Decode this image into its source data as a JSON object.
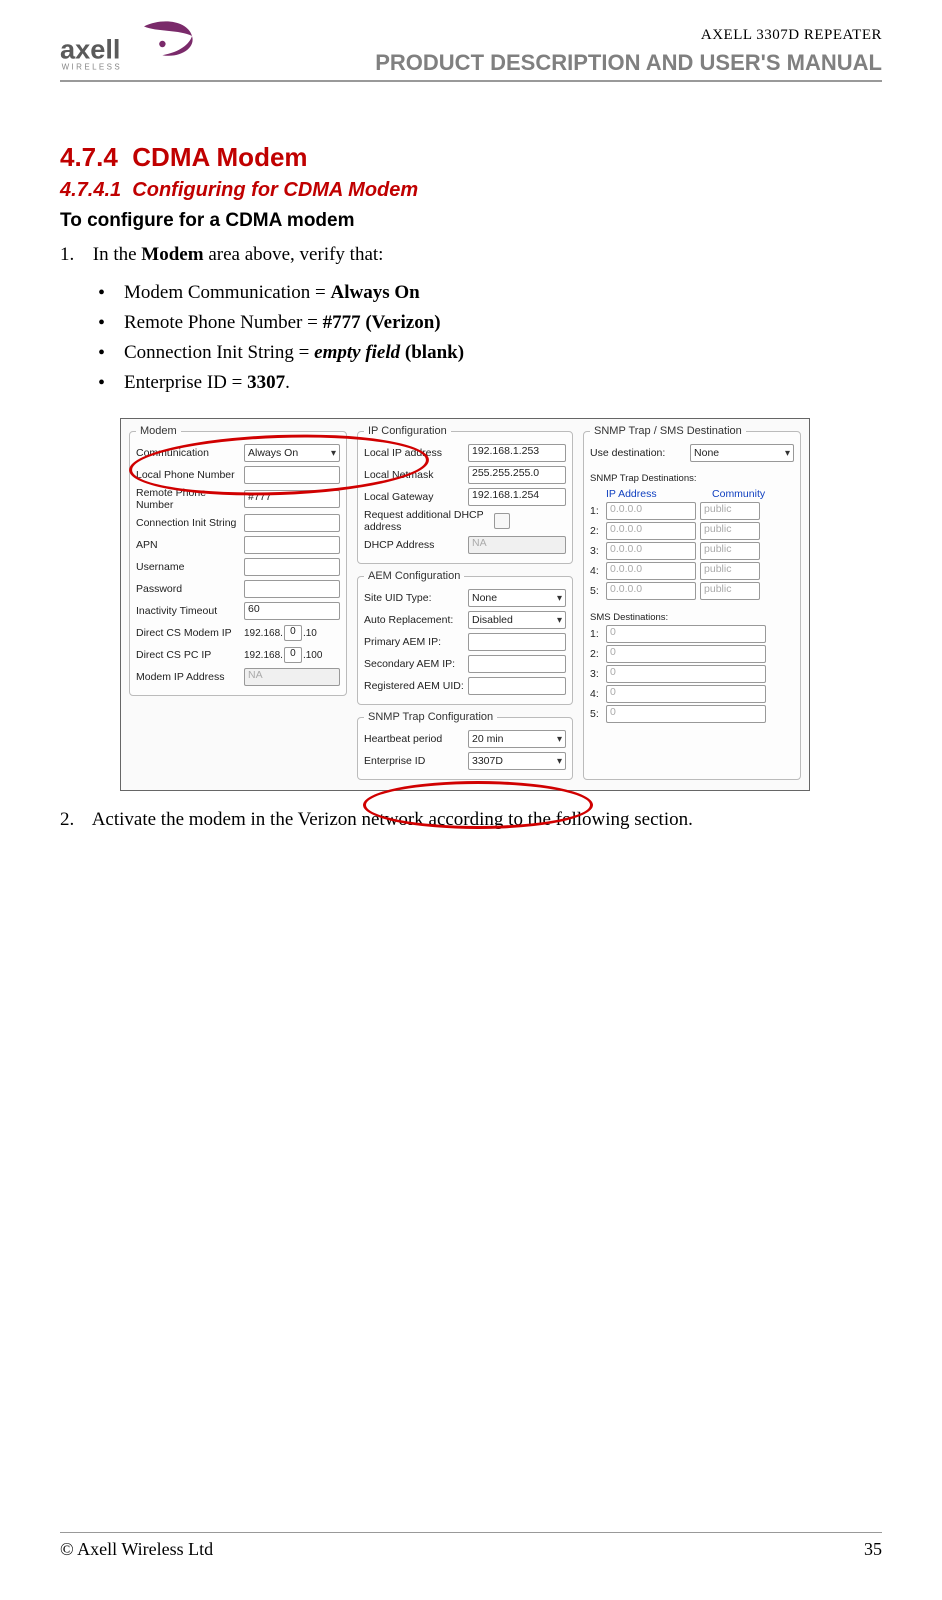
{
  "header": {
    "logo_brand": "axell",
    "logo_tag": "WIRELESS",
    "product": "AXELL 3307D REPEATER",
    "manual": "PRODUCT DESCRIPTION AND USER'S MANUAL"
  },
  "section": {
    "num_474": "4.7.4",
    "title_474": "CDMA Modem",
    "num_4741": "4.7.4.1",
    "title_4741": "Configuring for CDMA Modem",
    "proc_title": "To configure for a CDMA modem",
    "step1_prefix": "1.",
    "step1_text_a": "In the ",
    "step1_bold": "Modem",
    "step1_text_b": " area above, verify that:",
    "bullets": {
      "b1a": "Modem Communication  = ",
      "b1b": "Always On",
      "b2a": "Remote Phone Number = ",
      "b2b": "#777 (Verizon)",
      "b3a": "Connection Init String = ",
      "b3b_em": "empty field",
      "b3c": " (blank)",
      "b4a": "Enterprise ID = ",
      "b4b": "3307",
      "b4c": "."
    },
    "step2_prefix": "2.",
    "step2_text": "Activate the modem in the Verizon network according to the following section."
  },
  "fig": {
    "modem": {
      "legend": "Modem",
      "communication_label": "Communication",
      "communication_value": "Always On",
      "local_phone_label": "Local Phone Number",
      "local_phone_value": "",
      "remote_phone_label": "Remote Phone Number",
      "remote_phone_value": "#777",
      "conn_init_label": "Connection Init String",
      "conn_init_value": "",
      "apn_label": "APN",
      "apn_value": "",
      "username_label": "Username",
      "username_value": "",
      "password_label": "Password",
      "password_value": "",
      "inactivity_label": "Inactivity Timeout",
      "inactivity_value": "60",
      "cs_modem_label": "Direct CS Modem IP",
      "cs_modem_prefix": "192.168.",
      "cs_modem_oct": "0",
      "cs_modem_suffix": ".10",
      "cs_pc_label": "Direct CS PC IP",
      "cs_pc_prefix": "192.168.",
      "cs_pc_oct": "0",
      "cs_pc_suffix": ".100",
      "modem_ip_label": "Modem IP Address",
      "modem_ip_value": "NA"
    },
    "ipconf": {
      "legend": "IP Configuration",
      "local_ip_label": "Local IP address",
      "local_ip_value": "192.168.1.253",
      "netmask_label": "Local Netmask",
      "netmask_value": "255.255.255.0",
      "gateway_label": "Local Gateway",
      "gateway_value": "192.168.1.254",
      "dhcp_req_label": "Request additional DHCP address",
      "dhcp_addr_label": "DHCP Address",
      "dhcp_addr_value": "NA"
    },
    "aem": {
      "legend": "AEM Configuration",
      "site_uid_label": "Site UID Type:",
      "site_uid_value": "None",
      "auto_repl_label": "Auto Replacement:",
      "auto_repl_value": "Disabled",
      "primary_label": "Primary AEM IP:",
      "primary_value": "",
      "secondary_label": "Secondary AEM IP:",
      "secondary_value": "",
      "registered_label": "Registered AEM UID:",
      "registered_value": ""
    },
    "snmpconf": {
      "legend": "SNMP Trap Configuration",
      "heartbeat_label": "Heartbeat period",
      "heartbeat_value": "20 min",
      "enterprise_label": "Enterprise ID",
      "enterprise_value": "3307D"
    },
    "snmp": {
      "legend": "SNMP Trap / SMS Destination",
      "use_dest_label": "Use destination:",
      "use_dest_value": "None",
      "trap_dest_label": "SNMP Trap Destinations:",
      "col_ip": "IP Address",
      "col_comm": "Community",
      "rows": [
        {
          "idx": "1:",
          "ip": "0.0.0.0",
          "comm": "public"
        },
        {
          "idx": "2:",
          "ip": "0.0.0.0",
          "comm": "public"
        },
        {
          "idx": "3:",
          "ip": "0.0.0.0",
          "comm": "public"
        },
        {
          "idx": "4:",
          "ip": "0.0.0.0",
          "comm": "public"
        },
        {
          "idx": "5:",
          "ip": "0.0.0.0",
          "comm": "public"
        }
      ],
      "sms_label": "SMS Destinations:",
      "sms_rows": [
        {
          "idx": "1:",
          "val": "0"
        },
        {
          "idx": "2:",
          "val": "0"
        },
        {
          "idx": "3:",
          "val": "0"
        },
        {
          "idx": "4:",
          "val": "0"
        },
        {
          "idx": "5:",
          "val": "0"
        }
      ]
    }
  },
  "footer": {
    "copyright": "© Axell Wireless Ltd",
    "page": "35"
  }
}
